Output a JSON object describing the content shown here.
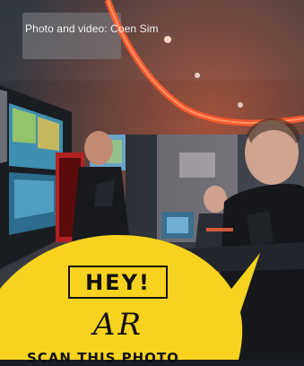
{
  "photo": {
    "credit": "Photo and video: Coen Sim"
  },
  "ar_badge": {
    "headline": "HEY!",
    "tag": "AR",
    "cta": "SCAN THIS PHOTO"
  },
  "colors": {
    "bubble": "#f7d31f",
    "ink": "#111111",
    "neon": "#ff5a2e"
  }
}
